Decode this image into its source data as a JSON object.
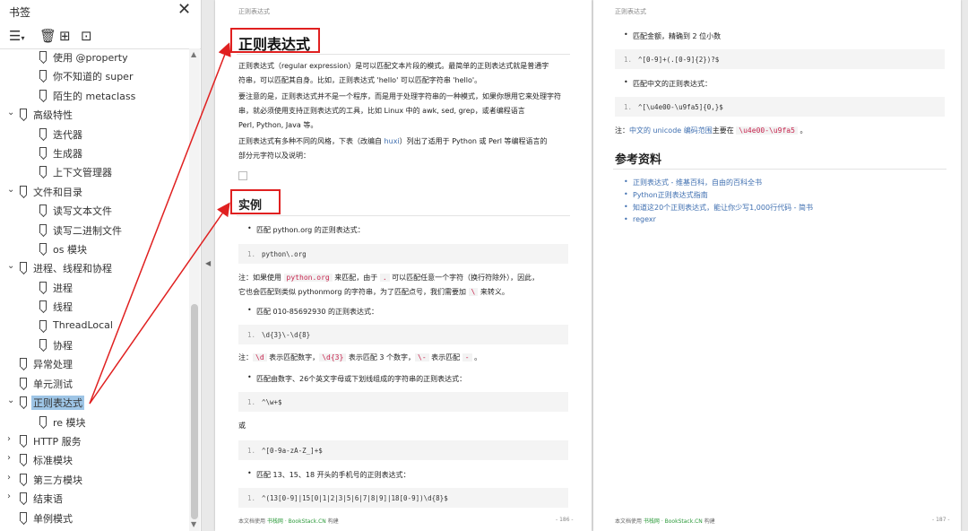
{
  "sidebar": {
    "title": "书签",
    "close_icon": "close-icon",
    "toolbar_icons": [
      "list-options-icon",
      "delete-icon",
      "add-bookmark-icon",
      "find-bookmark-icon"
    ],
    "items": [
      {
        "label": "使用 @property",
        "level": 2,
        "caret": ""
      },
      {
        "label": "你不知道的 super",
        "level": 2,
        "caret": ""
      },
      {
        "label": "陌生的 metaclass",
        "level": 2,
        "caret": ""
      },
      {
        "label": "高级特性",
        "level": 1,
        "caret": "expanded"
      },
      {
        "label": "迭代器",
        "level": 2,
        "caret": ""
      },
      {
        "label": "生成器",
        "level": 2,
        "caret": ""
      },
      {
        "label": "上下文管理器",
        "level": 2,
        "caret": ""
      },
      {
        "label": "文件和目录",
        "level": 1,
        "caret": "expanded"
      },
      {
        "label": "读写文本文件",
        "level": 2,
        "caret": ""
      },
      {
        "label": "读写二进制文件",
        "level": 2,
        "caret": ""
      },
      {
        "label": "os 模块",
        "level": 2,
        "caret": ""
      },
      {
        "label": "进程、线程和协程",
        "level": 1,
        "caret": "expanded"
      },
      {
        "label": "进程",
        "level": 2,
        "caret": ""
      },
      {
        "label": "线程",
        "level": 2,
        "caret": ""
      },
      {
        "label": "ThreadLocal",
        "level": 2,
        "caret": ""
      },
      {
        "label": "协程",
        "level": 2,
        "caret": ""
      },
      {
        "label": "异常处理",
        "level": 1,
        "caret": ""
      },
      {
        "label": "单元测试",
        "level": 1,
        "caret": ""
      },
      {
        "label": "正则表达式",
        "level": 1,
        "caret": "expanded",
        "selected": true
      },
      {
        "label": "re 模块",
        "level": 2,
        "caret": ""
      },
      {
        "label": "HTTP 服务",
        "level": 1,
        "caret": "collapsed"
      },
      {
        "label": "标准模块",
        "level": 1,
        "caret": "collapsed"
      },
      {
        "label": "第三方模块",
        "level": 1,
        "caret": "collapsed"
      },
      {
        "label": "结束语",
        "level": 1,
        "caret": "collapsed"
      },
      {
        "label": "单例模式",
        "level": 1,
        "caret": ""
      }
    ]
  },
  "page1": {
    "running_head": "正则表达式",
    "title": "正则表达式",
    "p1_line1": "正则表达式（regular expression）是可以匹配文本片段的模式。最简单的正则表达式就是普通字",
    "p1_line2": "符串，可以匹配其自身。比如，正则表达式 'hello' 可以匹配字符串 'hello'。",
    "p2_line1": "要注意的是，正则表达式并不是一个程序，而是用于处理字符串的一种模式，如果你想用它来处理字符",
    "p2_line2": "串，就必须使用支持正则表达式的工具，比如 Linux 中的 awk, sed, grep，或者编程语言",
    "p2_line3": "Perl, Python, Java 等。",
    "p3_line1_pre": "正则表达式有多种不同的风格，下表（改编自 ",
    "p3_link": "huxi",
    "p3_line1_post": "）列出了适用于 Python 或 Perl 等编程语言的",
    "p3_line2": "部分元字符以及说明：",
    "section_title": "实例",
    "b1": "匹配 python.org 的正则表达式：",
    "c1": "python\\.org",
    "n1_pre": "注：如果使用 ",
    "n1_code1": "python.org",
    "n1_mid": " 来匹配，由于 ",
    "n1_code2": ".",
    "n1_post": " 可以匹配任意一个字符（换行符除外），因此，",
    "n1_line2_pre": "它也会匹配到类似 pythonmorg 的字符串，为了匹配点号，我们需要加 ",
    "n1_code3": "\\",
    "n1_line2_post": " 来转义。",
    "b2": "匹配 010-85692930 的正则表达式：",
    "c2": "\\d{3}\\-\\d{8}",
    "n2_pre": "注：",
    "n2_code1": "\\d",
    "n2_t1": " 表示匹配数字，",
    "n2_code2": "\\d{3}",
    "n2_t2": " 表示匹配 3 个数字，",
    "n2_code3": "\\-",
    "n2_t3": " 表示匹配 ",
    "n2_code4": "-",
    "n2_t4": " 。",
    "b3": "匹配由数字、26个英文字母或下划线组成的字符串的正则表达式：",
    "c3": "^\\w+$",
    "or": "或",
    "c4": "^[0-9a-zA-Z_]+$",
    "b4": "匹配 13、15、18 开头的手机号的正则表达式：",
    "c5": "^(13[0-9]|15[0|1|2|3|5|6|7|8|9]|18[0-9])\\d{8}$",
    "footer_pre": "本文档使用 ",
    "footer_brand": "书栈网 · BookStack.CN",
    "footer_post": " 构建",
    "page_num": "- 186 -"
  },
  "page2": {
    "running_head": "正则表达式",
    "b1": "匹配金额，精确到 2 位小数",
    "c1": "^[0-9]+(.[0-9]{2})?$",
    "b2": "匹配中文的正则表达式：",
    "c2": "^[\\u4e00-\\u9fa5]{0,}$",
    "note_pre": "注：",
    "note_link": "中文的 unicode 编码范围",
    "note_mid": "主要在 ",
    "note_code": "\\u4e00-\\u9fa5",
    "note_post": " 。",
    "refs_title": "参考资料",
    "refs": [
      "正则表达式 - 维基百科，自由的百科全书",
      "Python正则表达式指南",
      "知道这20个正则表达式，能让你少写1,000行代码 - 简书",
      "regexr"
    ],
    "footer_pre": "本文档使用 ",
    "footer_brand": "书栈网 · BookStack.CN",
    "footer_post": " 构建",
    "page_num": "- 187 -"
  },
  "code_line_number": "1.",
  "colors": {
    "annotation": "#e02020",
    "selection": "#a9cbe8",
    "link": "#3f6fb0",
    "inline_code": "#c7254e"
  }
}
